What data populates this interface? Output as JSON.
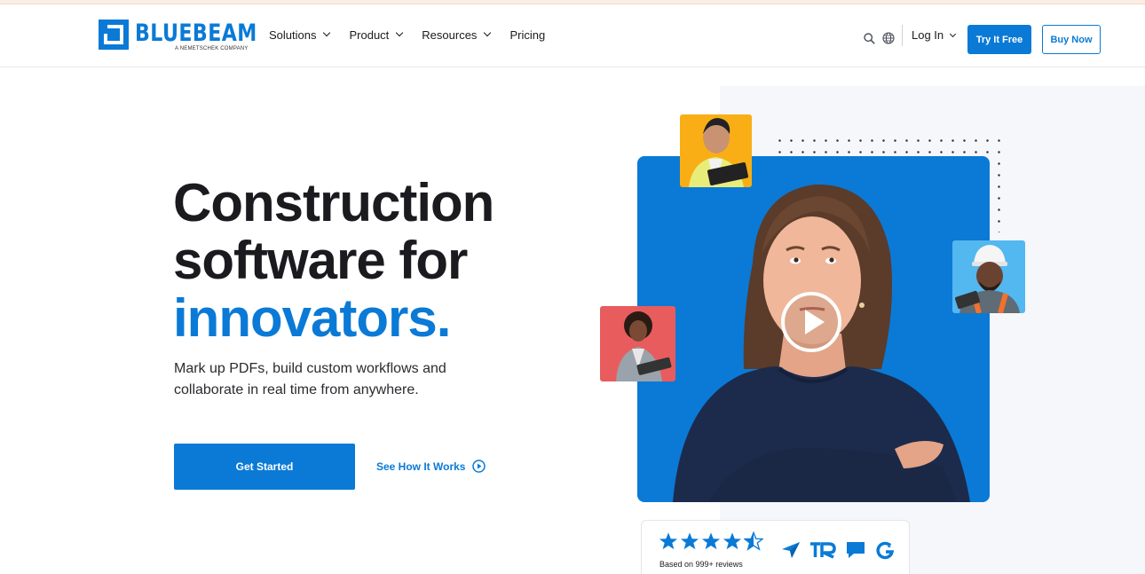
{
  "brand": {
    "name": "BLUEBEAM",
    "tagline": "A NEMETSCHEK COMPANY",
    "accent_color": "#0a7ad6"
  },
  "nav": {
    "items": [
      {
        "label": "Solutions",
        "has_dropdown": true
      },
      {
        "label": "Product",
        "has_dropdown": true
      },
      {
        "label": "Resources",
        "has_dropdown": true
      },
      {
        "label": "Pricing",
        "has_dropdown": false
      }
    ],
    "login_label": "Log In",
    "try_label": "Try It Free",
    "buy_label": "Buy Now",
    "icons": [
      "search-icon",
      "globe-icon"
    ]
  },
  "hero": {
    "headline_line1": "Construction",
    "headline_line2": "software for",
    "headline_accent": "innovators.",
    "subtext": "Mark up PDFs, build custom workflows and collaborate in real time from anywhere.",
    "cta_primary": "Get Started",
    "cta_secondary": "See How It Works"
  },
  "reviews": {
    "rating_stars": 4.5,
    "label": "Based on 999+ reviews",
    "sources": [
      "capterra-icon",
      "trustradius-icon",
      "software-advice-icon",
      "g2-icon"
    ]
  },
  "colors": {
    "video_card": "#0a7ad6",
    "thumb_yellow": "#f9ae16",
    "thumb_sky": "#53b7f0",
    "thumb_red": "#e95c5d"
  }
}
